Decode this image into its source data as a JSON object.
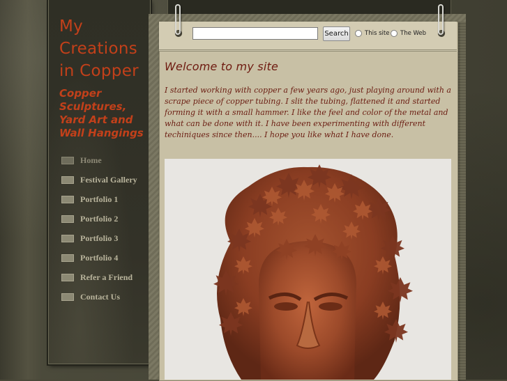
{
  "site": {
    "title": "My Creations in Copper",
    "tagline": "Copper Sculptures, Yard Art and Wall Hangings"
  },
  "nav": {
    "items": [
      {
        "label": "Home",
        "active": true
      },
      {
        "label": "Festival Gallery",
        "active": false
      },
      {
        "label": "Portfolio 1",
        "active": false
      },
      {
        "label": "Portfolio 2",
        "active": false
      },
      {
        "label": "Portfolio 3",
        "active": false
      },
      {
        "label": "Portfolio 4",
        "active": false
      },
      {
        "label": "Refer a Friend",
        "active": false
      },
      {
        "label": "Contact Us",
        "active": false
      }
    ]
  },
  "search": {
    "input_value": "",
    "button_label": "Search",
    "options": [
      {
        "label": "This site",
        "selected": false
      },
      {
        "label": "The Web",
        "selected": false
      }
    ]
  },
  "main": {
    "heading": "Welcome to my site",
    "intro": "I started working with copper a few years ago,  just playing around with a scrape piece of copper tubing.  I slit the tubing, flattened it and started forming it with a small hammer. I like the feel and color of the metal and what can be done with it.  I have been experimenting with different techiniques since then.... I hope you like what I have done.",
    "image_subject": "copper-leaf-mask-sculpture"
  },
  "colors": {
    "title": "#c2401a",
    "heading": "#6e1a10",
    "panel": "#c8c0a5",
    "sidebar": "#333228"
  }
}
